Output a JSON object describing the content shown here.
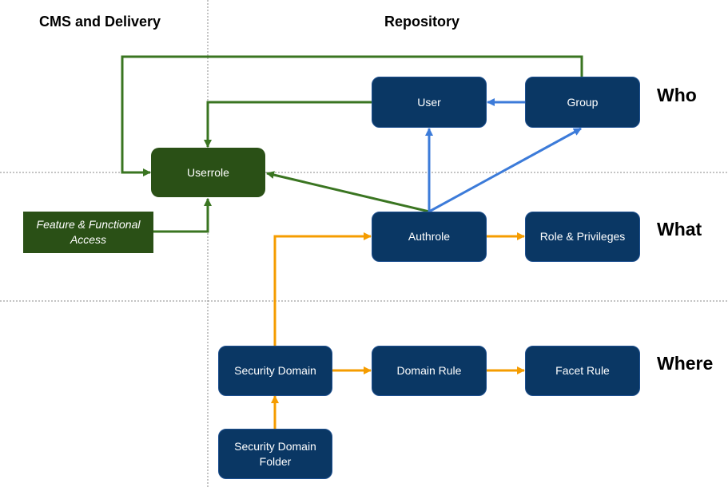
{
  "columns": {
    "cms": "CMS and Delivery",
    "repository": "Repository"
  },
  "rows": {
    "who": "Who",
    "what": "What",
    "where": "Where"
  },
  "nodes": {
    "userrole": "Userrole",
    "feature_access": "Feature & Functional Access",
    "user": "User",
    "group": "Group",
    "authrole": "Authrole",
    "role_privileges": "Role & Privileges",
    "security_domain": "Security Domain",
    "domain_rule": "Domain Rule",
    "facet_rule": "Facet Rule",
    "security_domain_folder": "Security Domain Folder"
  },
  "colors": {
    "green_edge": "#3a7521",
    "blue_edge": "#3c7bd9",
    "orange_edge": "#f59c00",
    "node_blue": "#0a3764",
    "node_green": "#2a5016",
    "grid": "#888888"
  },
  "edges": [
    {
      "from": "group",
      "to": "userrole",
      "color": "green"
    },
    {
      "from": "user",
      "to": "userrole",
      "color": "green"
    },
    {
      "from": "authrole",
      "to": "userrole",
      "color": "green"
    },
    {
      "from": "feature_access",
      "to": "userrole",
      "color": "green"
    },
    {
      "from": "group",
      "to": "user",
      "color": "blue"
    },
    {
      "from": "authrole",
      "to": "user",
      "color": "blue"
    },
    {
      "from": "authrole",
      "to": "group",
      "color": "blue"
    },
    {
      "from": "authrole",
      "to": "role_privileges",
      "color": "orange"
    },
    {
      "from": "security_domain",
      "to": "authrole",
      "color": "orange"
    },
    {
      "from": "security_domain",
      "to": "domain_rule",
      "color": "orange"
    },
    {
      "from": "domain_rule",
      "to": "facet_rule",
      "color": "orange"
    },
    {
      "from": "security_domain_folder",
      "to": "security_domain",
      "color": "orange"
    }
  ]
}
